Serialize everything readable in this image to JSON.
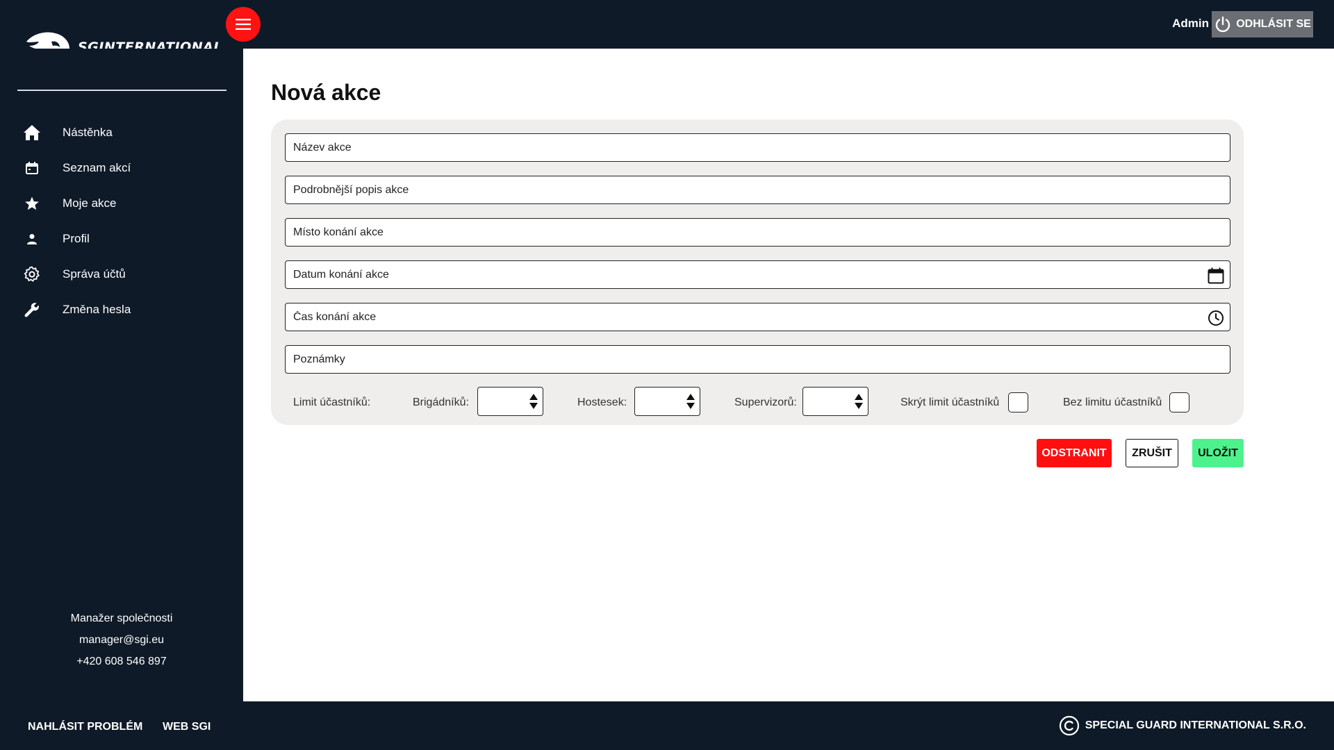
{
  "header": {
    "brand": "SGINTERNATIONAL",
    "menu_icon": "hamburger-menu-icon",
    "user_name": "Admin",
    "logout_label": "ODHLÁSIT SE",
    "logout_icon": "power-icon"
  },
  "sidebar": {
    "items": [
      {
        "label": "Nástěnka",
        "icon": "home-icon"
      },
      {
        "label": "Seznam akcí",
        "icon": "calendar-icon"
      },
      {
        "label": "Moje akce",
        "icon": "star-icon"
      },
      {
        "label": "Profil",
        "icon": "user-icon"
      },
      {
        "label": "Správa účtů",
        "icon": "gear-icon"
      },
      {
        "label": "Změna hesla",
        "icon": "wrench-icon"
      }
    ],
    "contact": {
      "title": "Manažer společnosti",
      "email": "manager@sgi.eu",
      "phone": "+420 608 546 897"
    }
  },
  "main": {
    "title": "Nová akce",
    "fields": {
      "name": {
        "placeholder": "Název akce",
        "value": ""
      },
      "description": {
        "placeholder": "Podrobnější popis akce",
        "value": ""
      },
      "location": {
        "placeholder": "Místo konání akce",
        "value": ""
      },
      "date": {
        "placeholder": "Datum konání akce",
        "value": "",
        "icon": "calendar-icon"
      },
      "time": {
        "placeholder": "Čas konání akce",
        "value": "",
        "icon": "clock-icon"
      },
      "notes": {
        "placeholder": "Poznámky",
        "value": ""
      }
    },
    "limits": {
      "label": "Limit účastníků:",
      "brigadnici_label": "Brigádníků:",
      "hostesky_label": "Hostesek:",
      "supervizori_label": "Supervizorů:",
      "hide_limit_label": "Skrýt limit účastníků",
      "no_limit_label": "Bez limitu účastníků",
      "hide_limit_checked": false,
      "no_limit_checked": false
    },
    "buttons": {
      "delete": "ODSTRANIT",
      "cancel": "ZRUŠIT",
      "save": "ULOŽIT"
    }
  },
  "footer": {
    "report_problem": "NAHLÁSIT PROBLÉM",
    "web_sgi": "WEB SGI",
    "copyright": "SPECIAL GUARD INTERNATIONAL S.R.O.",
    "copyright_icon": "copyright-icon"
  },
  "colors": {
    "dark_bg": "#0f1a28",
    "accent_red": "#ff0f0f",
    "save_green": "#4df28c",
    "panel_bg": "#efeeec",
    "logout_gray": "#6b6f74"
  }
}
